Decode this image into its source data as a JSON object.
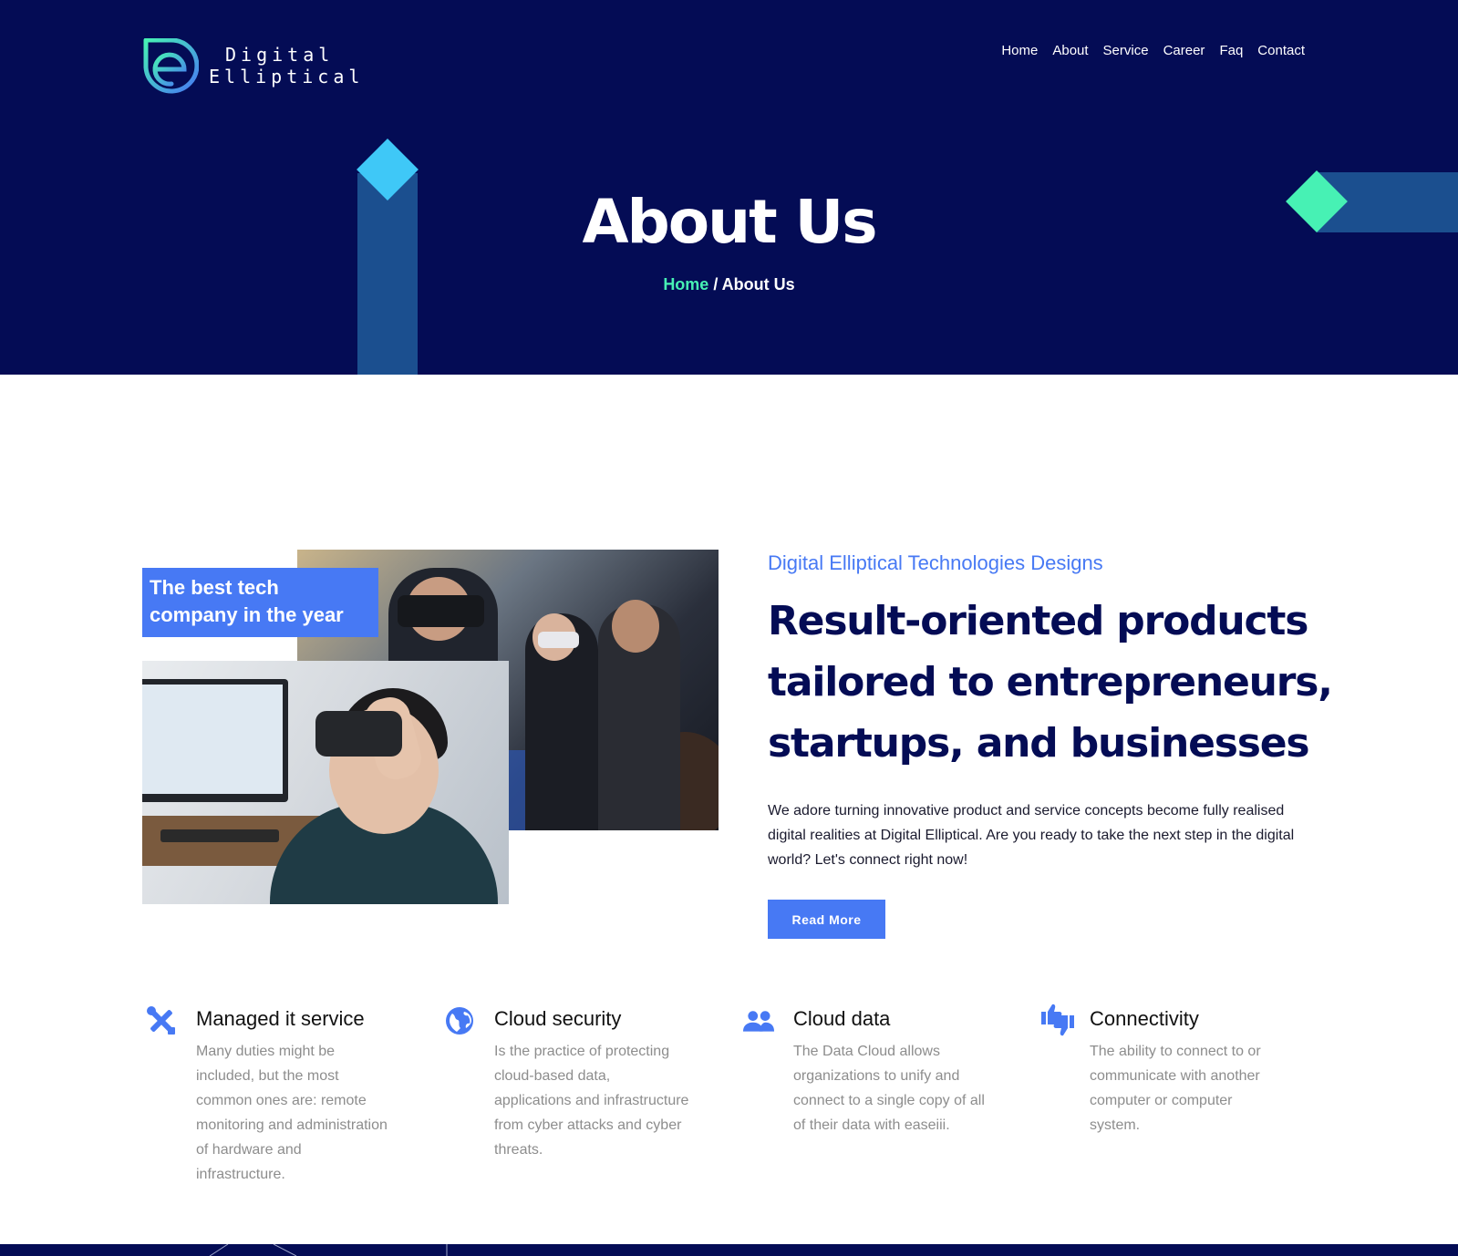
{
  "brand": {
    "line1": "Digital",
    "line2": "Elliptical"
  },
  "nav": {
    "items": [
      "Home",
      "About",
      "Service",
      "Career",
      "Faq",
      "Contact"
    ]
  },
  "hero": {
    "title": "About Us",
    "breadcrumb_home": "Home",
    "breadcrumb_separator": " / ",
    "breadcrumb_current": "About Us"
  },
  "about": {
    "badge": "The best tech company in the year",
    "subtitle": "Digital Elliptical Technologies Designs",
    "heading": "Result-oriented products tailored to entrepreneurs, startups, and businesses",
    "body": "We adore turning innovative product and service concepts become fully realised digital realities at Digital Elliptical. Are you ready to take the next step in the digital world? Let's connect right now!",
    "button": "Read More"
  },
  "features": [
    {
      "icon": "tools-icon",
      "title": "Managed it service",
      "desc": "Many duties might be included, but the most common ones are: remote monitoring and administration of hardware and infrastructure."
    },
    {
      "icon": "globe-icon",
      "title": "Cloud security",
      "desc": "Is the practice of protecting cloud-based data, applications and infrastructure from cyber attacks and cyber threats."
    },
    {
      "icon": "users-icon",
      "title": "Cloud data",
      "desc": "The Data Cloud allows organizations to unify and connect to a single copy of all of their data with easeiii."
    },
    {
      "icon": "thumbs-icon",
      "title": "Connectivity",
      "desc": "The ability to connect to or communicate with another computer or computer system."
    }
  ],
  "colors": {
    "navy": "#040c55",
    "accent_blue": "#4779f4",
    "mint": "#47f1b4",
    "cyan": "#3fc8f7",
    "steel": "#1b4f8f"
  }
}
